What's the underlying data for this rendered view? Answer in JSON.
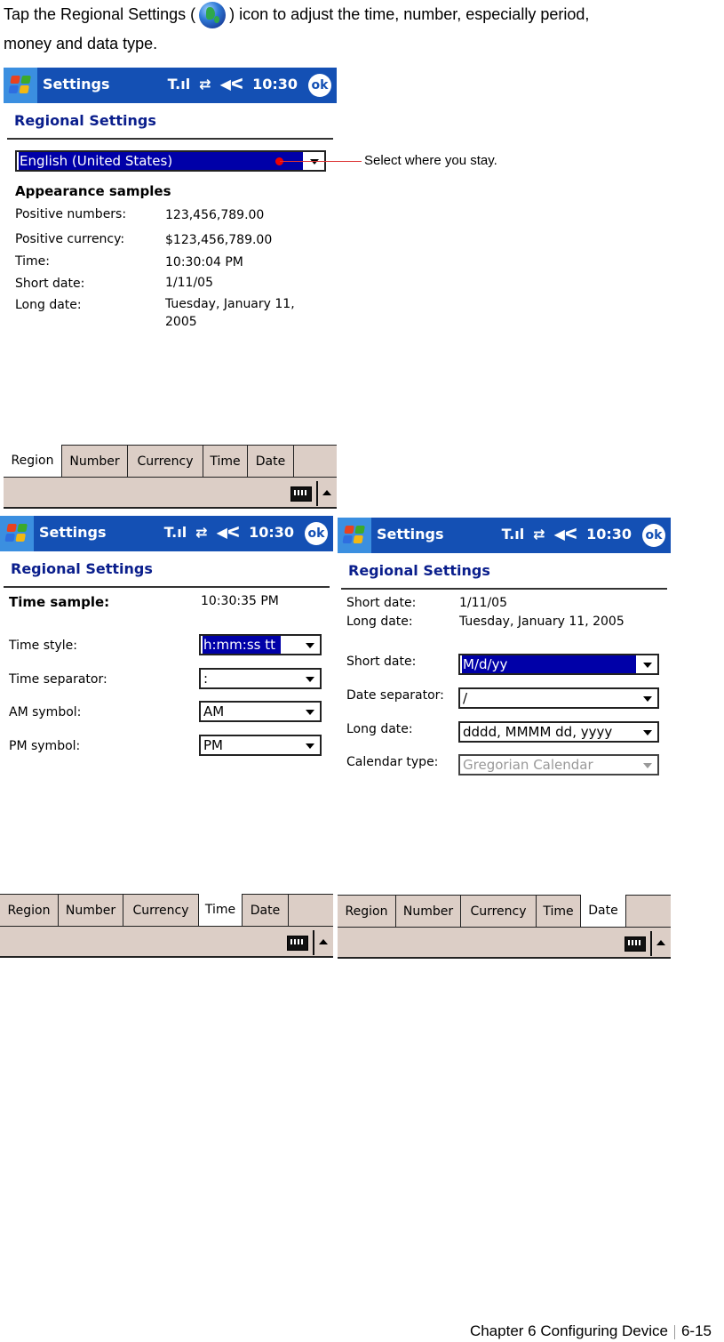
{
  "intro": {
    "text_before_icon": "Tap the Regional Settings (",
    "icon": "globe-icon",
    "text_after_icon": ") icon to adjust the time, number, especially period,",
    "line2": "money and data type."
  },
  "common": {
    "app_title": "Settings",
    "clock": "10:30",
    "ok_label": "ok",
    "heading": "Regional Settings",
    "status_icons": [
      "signal-icon",
      "sync-arrows-icon",
      "speaker-icon"
    ],
    "tabs": [
      "Region",
      "Number",
      "Currency",
      "Time",
      "Date"
    ]
  },
  "region_screen": {
    "active_tab": "Region",
    "locale_value": "English (United States)",
    "samples_heading": "Appearance samples",
    "samples": [
      {
        "label": "Positive numbers:",
        "value": "123,456,789.00"
      },
      {
        "label": "Positive currency:",
        "value": "$123,456,789.00"
      },
      {
        "label": "Time:",
        "value": "10:30:04 PM"
      },
      {
        "label": "Short date:",
        "value": "1/11/05"
      },
      {
        "label": "Long date:",
        "value": "Tuesday, January 11,",
        "value2": "2005"
      }
    ],
    "callout": "Select where you stay."
  },
  "time_screen": {
    "active_tab": "Time",
    "sample_label": "Time sample:",
    "sample_value": "10:30:35 PM",
    "fields": [
      {
        "label": "Time style:",
        "value": "h:mm:ss tt"
      },
      {
        "label": "Time separator:",
        "value": ":"
      },
      {
        "label": "AM symbol:",
        "value": "AM"
      },
      {
        "label": "PM symbol:",
        "value": "PM"
      }
    ]
  },
  "date_screen": {
    "active_tab": "Date",
    "samples": [
      {
        "label": "Short date:",
        "value": "1/11/05"
      },
      {
        "label": "Long date:",
        "value": "Tuesday, January 11, 2005"
      }
    ],
    "fields": [
      {
        "label": "Short date:",
        "value": "M/d/yy"
      },
      {
        "label": "Date separator:",
        "value": "/"
      },
      {
        "label": "Long date:",
        "value": "dddd, MMMM dd, yyyy"
      },
      {
        "label": "Calendar type:",
        "value": "Gregorian Calendar"
      }
    ]
  },
  "footer": {
    "chapter": "Chapter 6 Configuring Device",
    "page": "6-15"
  }
}
